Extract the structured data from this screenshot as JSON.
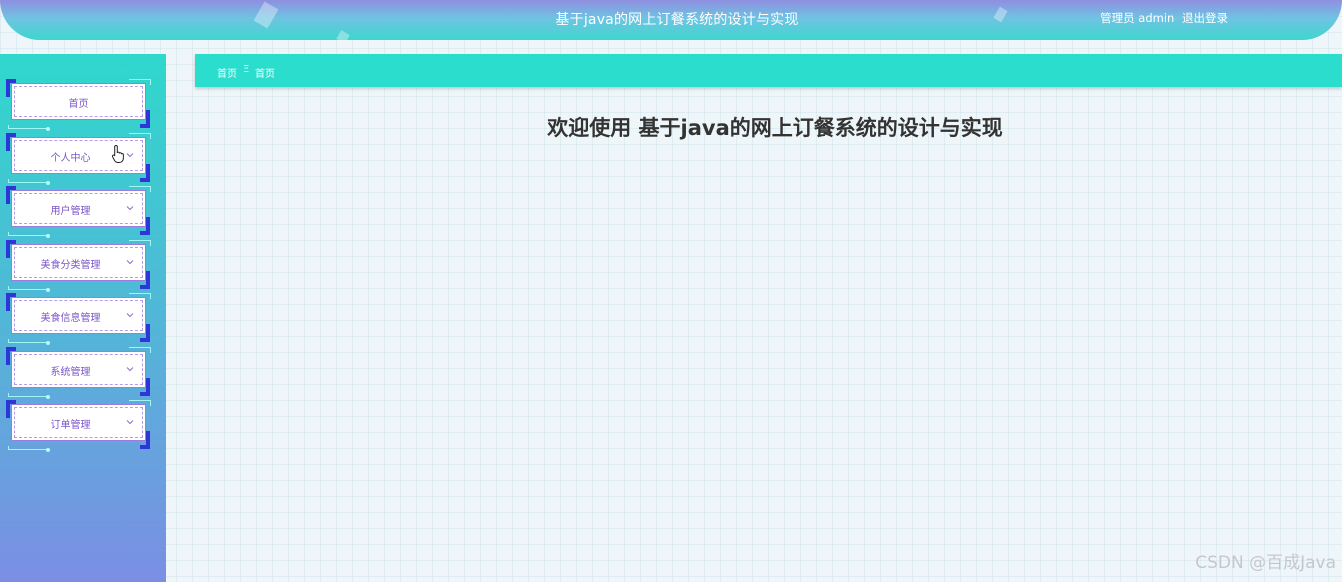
{
  "header": {
    "title": "基于java的网上订餐系统的设计与实现",
    "user_label": "管理员 admin",
    "logout_label": "退出登录"
  },
  "sidebar": {
    "items": [
      {
        "label": "首页",
        "expandable": false
      },
      {
        "label": "个人中心",
        "expandable": true
      },
      {
        "label": "用户管理",
        "expandable": true
      },
      {
        "label": "美食分类管理",
        "expandable": true
      },
      {
        "label": "美食信息管理",
        "expandable": true
      },
      {
        "label": "系统管理",
        "expandable": true
      },
      {
        "label": "订单管理",
        "expandable": true
      }
    ]
  },
  "breadcrumb": {
    "first": "首页",
    "separator": "Ξ",
    "second": "首页"
  },
  "main": {
    "welcome": "欢迎使用 基于java的网上订餐系统的设计与实现"
  },
  "watermark": "CSDN @百成Java",
  "colors": {
    "accent_teal": "#2bddcd",
    "menu_corner": "#2e36d8",
    "menu_text": "#7b55c9"
  }
}
